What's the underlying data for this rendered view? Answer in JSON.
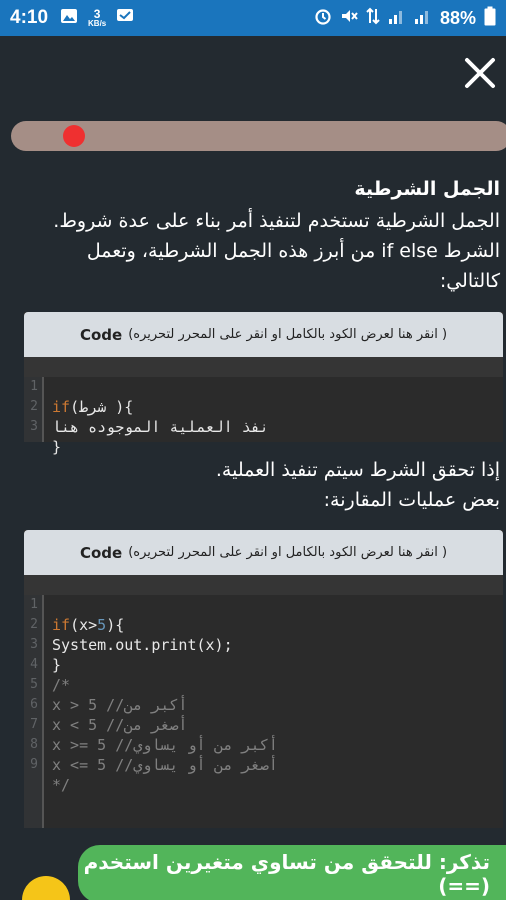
{
  "status_bar": {
    "time": "4:10",
    "speed_value": "3",
    "speed_unit": "KB/s",
    "battery": "88%",
    "icons": [
      "image-icon",
      "chat-icon",
      "alarm-icon",
      "mute-icon",
      "data-icon",
      "signal-icon",
      "signal-icon",
      "battery-icon"
    ]
  },
  "lesson": {
    "heading": "الجمل الشرطية",
    "intro_line1": "الجمل الشرطية تستخدم لتنفيذ أمر بناء على عدة شروط.",
    "intro_line2": "الشرط if else من أبرز هذه الجمل الشرطية، وتعمل",
    "intro_line3": "كالتالي:",
    "middle_line1": "إذا تحقق الشرط سيتم تنفيذ العملية.",
    "middle_line2": "بعض عمليات المقارنة:"
  },
  "code_blocks": [
    {
      "header_code": "Code",
      "header_hint": "(انقر هنا لعرض الكود بالكامل او انقر على المحرر لتحريره )",
      "lines": [
        {
          "n": "1",
          "pre": "",
          "kw": "if",
          "post": "(شرط ){"
        },
        {
          "n": "2",
          "pre": "",
          "kw": "",
          "post": "نفذ العملية الموجوده هنا"
        },
        {
          "n": "3",
          "pre": "",
          "kw": "",
          "post": "}"
        }
      ]
    },
    {
      "header_code": "Code",
      "header_hint": "(انقر هنا لعرض الكود بالكامل او انقر على المحرر لتحريره )",
      "lines": [
        {
          "n": "1",
          "text_kw": "if",
          "text_a": "(x>",
          "text_num": "5",
          "text_b": "){"
        },
        {
          "n": "2",
          "text": "System.out.print(x);"
        },
        {
          "n": "3",
          "text": "}"
        },
        {
          "n": "4",
          "comment": "/*"
        },
        {
          "n": "5",
          "comment": "x > 5 //أكبر من"
        },
        {
          "n": "6",
          "comment": "x < 5 //أصغر من"
        },
        {
          "n": "7",
          "comment": "x >= 5 //أكبر من أو يساوي"
        },
        {
          "n": "8",
          "comment": "x <= 5 //أصغر من أو يساوي"
        },
        {
          "n": "9",
          "comment": "*/"
        }
      ]
    }
  ],
  "tip": "تذكر: للتحقق من تساوي متغيرين استخدم (==)",
  "progress": {
    "fraction": 0.12
  },
  "colors": {
    "status_bar": "#1a75bd",
    "background": "#232a30",
    "progress_track": "#a58e86",
    "progress_dot": "#ef3030",
    "toast": "#52b55a",
    "fab": "#f5c518"
  }
}
